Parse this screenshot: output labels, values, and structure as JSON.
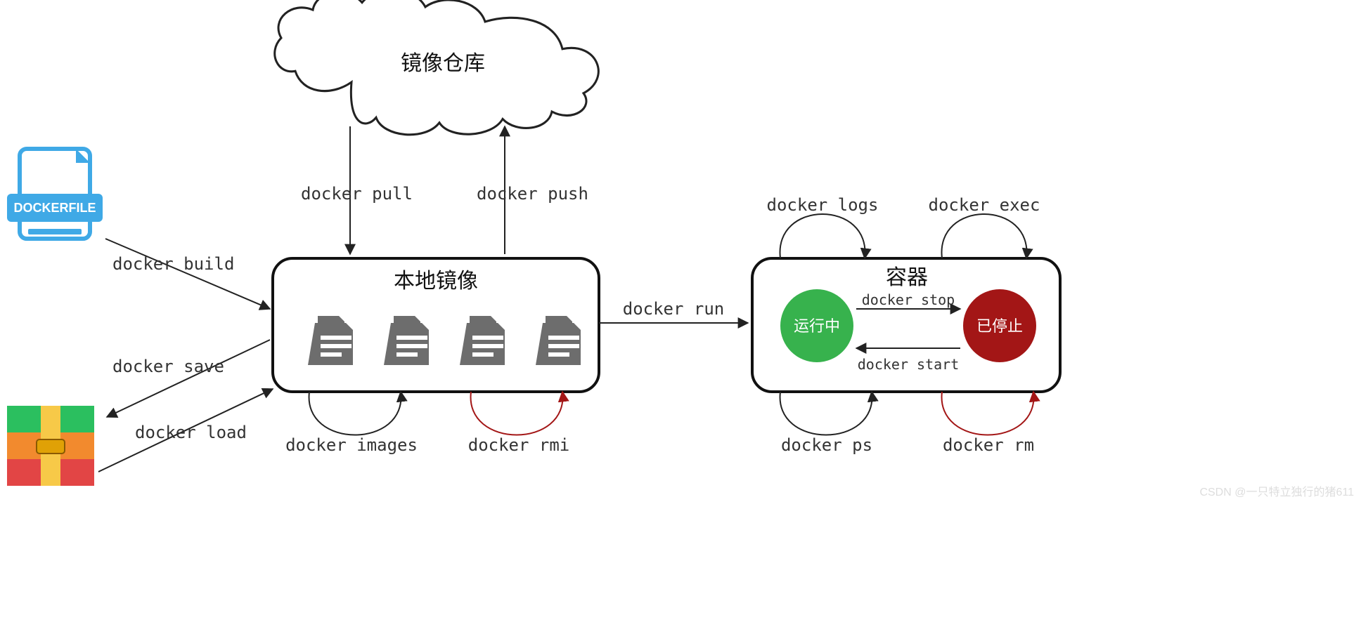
{
  "nodes": {
    "registry": "镜像仓库",
    "local_images": "本地镜像",
    "container": "容器",
    "running": "运行中",
    "stopped": "已停止",
    "dockerfile": "DOCKERFILE"
  },
  "edges": {
    "pull": "docker pull",
    "push": "docker push",
    "build": "docker build",
    "save": "docker save",
    "load": "docker load",
    "images": "docker images",
    "rmi": "docker rmi",
    "run": "docker run",
    "logs": "docker logs",
    "exec": "docker exec",
    "stop": "docker stop",
    "start": "docker start",
    "ps": "docker ps",
    "rm": "docker rm"
  },
  "watermark": "CSDN @一只特立独行的猪611"
}
